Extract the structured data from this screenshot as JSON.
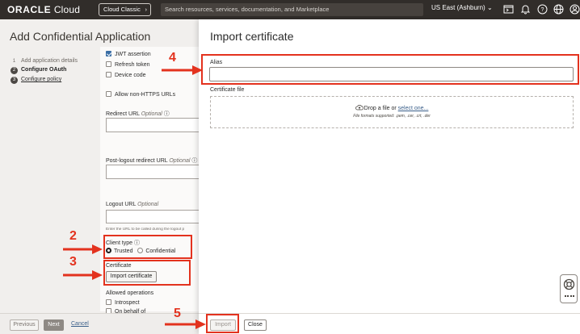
{
  "topbar": {
    "brand_bold": "ORACLE",
    "brand_light": " Cloud",
    "cloud_classic": "Cloud Classic",
    "search_placeholder": "Search resources, services, documentation, and Marketplace",
    "region": "US East (Ashburn)",
    "icons": [
      "code-editor-icon",
      "bell-icon",
      "help-icon",
      "globe-icon",
      "user-icon"
    ]
  },
  "wizard": {
    "title": "Add Confidential Application",
    "steps": [
      {
        "num": "1",
        "label": "Add application details"
      },
      {
        "num": "2",
        "label": "Configure OAuth"
      },
      {
        "num": "3",
        "label": "Configure policy"
      }
    ]
  },
  "form": {
    "grant_types": [
      {
        "label": "JWT assertion",
        "checked": true
      },
      {
        "label": "Refresh token",
        "checked": false
      },
      {
        "label": "Device code",
        "checked": false
      }
    ],
    "allow_non_https": "Allow non-HTTPS URLs",
    "redirect_url_label": "Redirect URL",
    "optional": "Optional",
    "post_logout_label": "Post-logout redirect URL",
    "logout_url_label": "Logout URL",
    "logout_hint": "Enter the URL to be called during the logout p",
    "client_type_label": "Client type",
    "client_types": [
      "Trusted",
      "Confidential"
    ],
    "certificate_label": "Certificate",
    "import_certificate_button": "Import certificate",
    "allowed_operations_label": "Allowed operations",
    "operations": [
      "Introspect",
      "On behalf of"
    ]
  },
  "wizard_footer": {
    "previous": "Previous",
    "next": "Next",
    "cancel": "Cancel"
  },
  "dialog": {
    "title": "Import certificate",
    "alias_label": "Alias",
    "alias_value": "",
    "certificate_file_label": "Certificate file",
    "drop_text": "Drop a file or ",
    "select_link": "select one...",
    "formats": "File formats supported: .pem, .cer, .crt, .der",
    "import_button": "Import",
    "close_button": "Close"
  },
  "annotations": {
    "n2": "2",
    "n3": "3",
    "n4": "4",
    "n5": "5",
    "color": "#e3321e"
  }
}
